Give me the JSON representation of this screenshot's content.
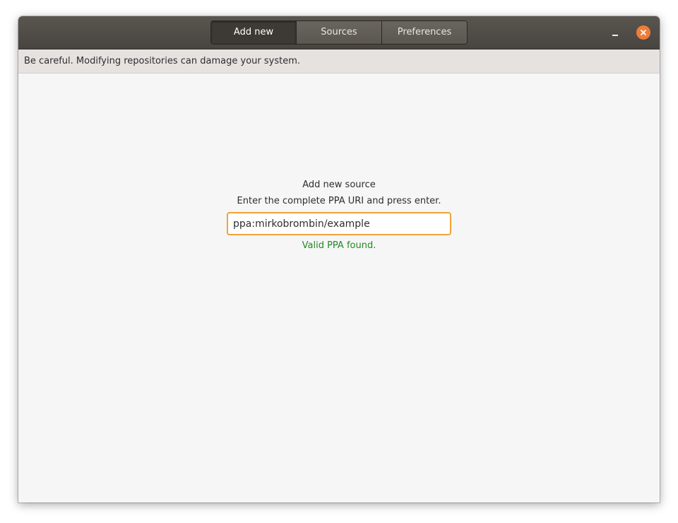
{
  "header": {
    "tabs": [
      {
        "label": "Add new",
        "active": true
      },
      {
        "label": "Sources",
        "active": false
      },
      {
        "label": "Preferences",
        "active": false
      }
    ],
    "close_icon": "close-icon",
    "minimize_icon": "minimize-icon",
    "close_color": "#ec7e3a"
  },
  "infobar": {
    "message": "Be careful. Modifying repositories can damage your system."
  },
  "main": {
    "heading": "Add new source",
    "instruction": "Enter the complete PPA URI and press enter.",
    "ppa_input": {
      "value": "ppa:mirkobrombin/example",
      "placeholder": ""
    },
    "status": "Valid PPA found.",
    "status_color": "#1f8a1f",
    "focus_color": "#f0a33a"
  }
}
